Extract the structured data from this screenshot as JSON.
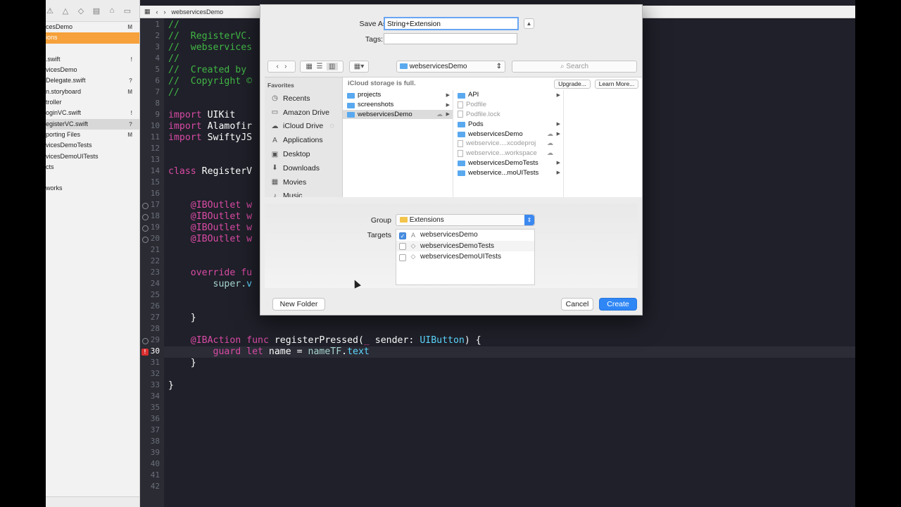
{
  "navigator": {
    "items": [
      {
        "label": "cesDemo",
        "badge": "M",
        "state": "normal"
      },
      {
        "label": "ions",
        "badge": "",
        "state": "orange"
      },
      {
        "label": "",
        "badge": "",
        "state": "normal"
      },
      {
        "label": ".swift",
        "badge": "!",
        "state": "normal"
      },
      {
        "label": "vicesDemo",
        "badge": "",
        "state": "normal"
      },
      {
        "label": "Delegate.swift",
        "badge": "?",
        "state": "normal"
      },
      {
        "label": "n.storyboard",
        "badge": "M",
        "state": "normal"
      },
      {
        "label": "troller",
        "badge": "",
        "state": "normal"
      },
      {
        "label": "oginVC.swift",
        "badge": "!",
        "state": "normal"
      },
      {
        "label": "egisterVC.swift",
        "badge": "?",
        "state": "sel"
      },
      {
        "label": "porting Files",
        "badge": "M",
        "state": "normal"
      },
      {
        "label": "vicesDemoTests",
        "badge": "",
        "state": "normal"
      },
      {
        "label": "vicesDemoUITests",
        "badge": "",
        "state": "normal"
      },
      {
        "label": "cts",
        "badge": "",
        "state": "normal"
      },
      {
        "label": "",
        "badge": "",
        "state": "normal"
      },
      {
        "label": "works",
        "badge": "",
        "state": "normal"
      }
    ]
  },
  "editor": {
    "jumpbar": {
      "file": "webservicesDemo"
    },
    "current_line": 30,
    "gutter_marks": [
      17,
      18,
      19,
      20,
      29
    ],
    "error_line": 30,
    "error_symbol": "!",
    "line_numbers": [
      "1",
      "2",
      "3",
      "4",
      "5",
      "6",
      "7",
      "8",
      "9",
      "10",
      "11",
      "12",
      "13",
      "14",
      "15",
      "16",
      "17",
      "18",
      "19",
      "20",
      "21",
      "22",
      "23",
      "24",
      "25",
      "26",
      "27",
      "28",
      "29",
      "30",
      "31",
      "32",
      "33",
      "34",
      "35",
      "36",
      "37",
      "38",
      "39",
      "40",
      "41",
      "42"
    ],
    "lines": [
      [
        {
          "t": "//",
          "c": "c"
        }
      ],
      [
        {
          "t": "//  RegisterVC.",
          "c": "c"
        }
      ],
      [
        {
          "t": "//  webservices",
          "c": "c"
        }
      ],
      [
        {
          "t": "//",
          "c": "c"
        }
      ],
      [
        {
          "t": "//  Created by",
          "c": "c"
        }
      ],
      [
        {
          "t": "//  Copyright ©",
          "c": "c"
        }
      ],
      [
        {
          "t": "//",
          "c": "c"
        }
      ],
      [],
      [
        {
          "t": "import",
          "c": "k"
        },
        {
          "t": " UIKit",
          "c": "plain"
        }
      ],
      [
        {
          "t": "import",
          "c": "k"
        },
        {
          "t": " Alamofir",
          "c": "plain"
        }
      ],
      [
        {
          "t": "import",
          "c": "k"
        },
        {
          "t": " SwiftyJS",
          "c": "plain"
        }
      ],
      [],
      [],
      [
        {
          "t": "class",
          "c": "k"
        },
        {
          "t": " RegisterV",
          "c": "plain"
        }
      ],
      [],
      [],
      [
        {
          "t": "    @IBOutlet w",
          "c": "attr"
        }
      ],
      [
        {
          "t": "    @IBOutlet w",
          "c": "attr"
        }
      ],
      [
        {
          "t": "    @IBOutlet w",
          "c": "attr"
        }
      ],
      [
        {
          "t": "    @IBOutlet w",
          "c": "attr"
        }
      ],
      [],
      [],
      [
        {
          "t": "    override fu",
          "c": "k"
        }
      ],
      [
        {
          "t": "        super.",
          "c": "p"
        },
        {
          "t": "v",
          "c": "t"
        }
      ],
      [],
      [],
      [
        {
          "t": "    }",
          "c": "plain"
        }
      ],
      [],
      [
        {
          "t": "    @IBAction",
          "c": "attr"
        },
        {
          "t": " func",
          "c": "k"
        },
        {
          "t": " registerPressed(",
          "c": "plain"
        },
        {
          "t": "_",
          "c": "k"
        },
        {
          "t": " sender: ",
          "c": "plain"
        },
        {
          "t": "UIButton",
          "c": "t"
        },
        {
          "t": ") {",
          "c": "plain"
        }
      ],
      [
        {
          "t": "        guard",
          "c": "k"
        },
        {
          "t": " let",
          "c": "k"
        },
        {
          "t": " name = ",
          "c": "plain"
        },
        {
          "t": "nameTF",
          "c": "p"
        },
        {
          "t": ".",
          "c": "plain"
        },
        {
          "t": "text",
          "c": "t"
        }
      ],
      [
        {
          "t": "    }",
          "c": "plain"
        }
      ],
      [],
      [
        {
          "t": "}",
          "c": "plain"
        }
      ],
      [],
      [],
      [],
      [],
      [],
      [],
      [],
      [],
      []
    ]
  },
  "dialog": {
    "save_as_label": "Save As:",
    "save_as_value": "String+Extension",
    "tags_label": "Tags:",
    "location": "webservicesDemo",
    "search_placeholder": "Search",
    "icloud_message": "iCloud storage is full.",
    "upgrade_label": "Upgrade...",
    "learn_more_label": "Learn More...",
    "favorites_header": "Favorites",
    "favorites": [
      {
        "label": "Recents",
        "icon": "clock-icon"
      },
      {
        "label": "Amazon Drive",
        "icon": "folder-icon"
      },
      {
        "label": "iCloud Drive",
        "icon": "cloud-icon"
      },
      {
        "label": "Applications",
        "icon": "apps-icon"
      },
      {
        "label": "Desktop",
        "icon": "desktop-icon"
      },
      {
        "label": "Downloads",
        "icon": "download-icon"
      },
      {
        "label": "Movies",
        "icon": "film-icon"
      },
      {
        "label": "Music",
        "icon": "music-icon"
      }
    ],
    "col1": [
      {
        "label": "projects",
        "kind": "folder",
        "arrow": true,
        "sel": false
      },
      {
        "label": "screenshots",
        "kind": "folder",
        "arrow": true,
        "sel": false
      },
      {
        "label": "webservicesDemo",
        "kind": "folder",
        "arrow": true,
        "sel": true,
        "cloud": true
      }
    ],
    "col2": [
      {
        "label": "API",
        "kind": "folder",
        "arrow": true
      },
      {
        "label": "Podfile",
        "kind": "doc",
        "dim": true
      },
      {
        "label": "Podfile.lock",
        "kind": "doc",
        "dim": true
      },
      {
        "label": "Pods",
        "kind": "folder",
        "arrow": true
      },
      {
        "label": "webservicesDemo",
        "kind": "folder",
        "arrow": true,
        "cloud": true
      },
      {
        "label": "webservice....xcodeproj",
        "kind": "doc",
        "dim": true,
        "cloud": true
      },
      {
        "label": "webservice...workspace",
        "kind": "doc",
        "dim": true,
        "cloud": true
      },
      {
        "label": "webservicesDemoTests",
        "kind": "folder",
        "arrow": true
      },
      {
        "label": "webservice...moUITests",
        "kind": "folder",
        "arrow": true
      }
    ],
    "group_label": "Group",
    "group_value": "Extensions",
    "targets_label": "Targets",
    "targets": [
      {
        "label": "webservicesDemo",
        "checked": true
      },
      {
        "label": "webservicesDemoTests",
        "checked": false
      },
      {
        "label": "webservicesDemoUITests",
        "checked": false
      }
    ],
    "new_folder_label": "New Folder",
    "cancel_label": "Cancel",
    "create_label": "Create"
  },
  "colors": {
    "accent": "#2f86f5",
    "comment": "#41b645",
    "keyword": "#d94aa5",
    "type": "#5dd8ff",
    "selection_nav": "#f6a13b"
  }
}
